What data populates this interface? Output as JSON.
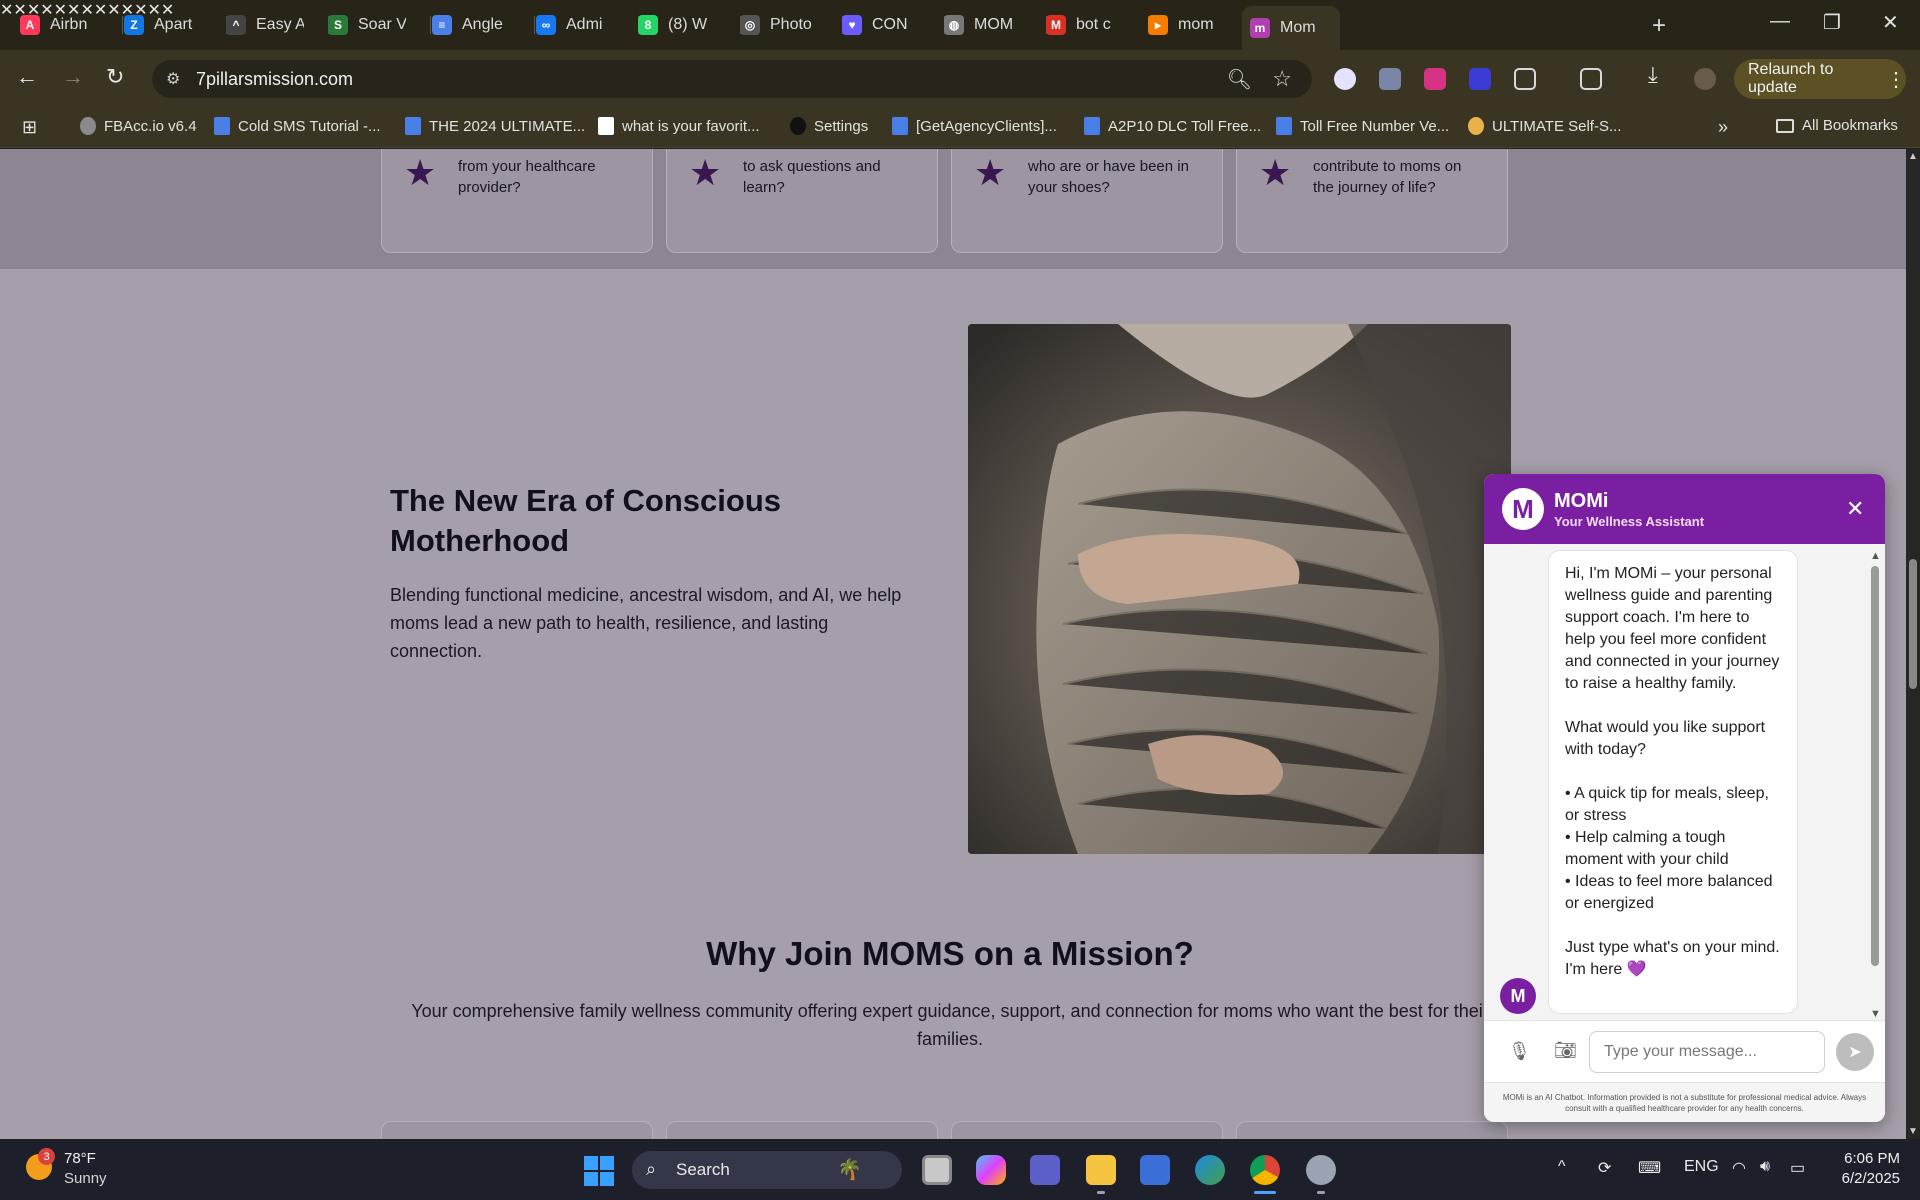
{
  "browser": {
    "tabs": [
      {
        "title": "Airbn",
        "icon": "airbnb-icon",
        "color": "#ff385c",
        "glyph": "A"
      },
      {
        "title": "Apart",
        "icon": "zillow-icon",
        "color": "#1277e1",
        "glyph": "Z"
      },
      {
        "title": "Easy A",
        "icon": "easy-icon",
        "color": "#444444",
        "glyph": "^"
      },
      {
        "title": "Soar V",
        "icon": "soar-icon",
        "color": "#2a7a3a",
        "glyph": "S"
      },
      {
        "title": "Angle",
        "icon": "docs-icon",
        "color": "#4a7fe8",
        "glyph": "≡"
      },
      {
        "title": "Admi",
        "icon": "meta-icon",
        "color": "#1877f2",
        "glyph": "∞"
      },
      {
        "title": "(8) W",
        "icon": "whatsapp-icon",
        "color": "#25d366",
        "glyph": "8"
      },
      {
        "title": "Photo",
        "icon": "openai-icon",
        "color": "#555555",
        "glyph": "◎"
      },
      {
        "title": "CON",
        "icon": "heart-chat-icon",
        "color": "#6a5cff",
        "glyph": "♥"
      },
      {
        "title": "MOM",
        "icon": "globe-icon",
        "color": "#777777",
        "glyph": "◍"
      },
      {
        "title": "bot c",
        "icon": "gmail-icon",
        "color": "#d93025",
        "glyph": "M"
      },
      {
        "title": "mom",
        "icon": "make-icon",
        "color": "#f57c00",
        "glyph": "▸"
      },
      {
        "title": "Mom",
        "icon": "mom-site-icon",
        "color": "#b03fb0",
        "glyph": "m"
      }
    ],
    "url": "7pillarsmission.com",
    "relaunch_label": "Relaunch to update",
    "bookmarks": [
      {
        "label": "FBAcc.io v6.4",
        "kind": "globe"
      },
      {
        "label": "Cold SMS Tutorial -...",
        "kind": "doc"
      },
      {
        "label": "THE 2024 ULTIMATE...",
        "kind": "doc"
      },
      {
        "label": "what is your favorit...",
        "kind": "ye"
      },
      {
        "label": "Settings",
        "kind": "tri"
      },
      {
        "label": "[GetAgencyClients]...",
        "kind": "doc"
      },
      {
        "label": "A2P10 DLC Toll Free...",
        "kind": "doc"
      },
      {
        "label": "Toll Free Number Ve...",
        "kind": "doc"
      },
      {
        "label": "ULTIMATE Self-S...",
        "kind": "emoji"
      }
    ],
    "all_bookmarks": "All Bookmarks",
    "more_bookmarks": "»"
  },
  "page": {
    "cards_top": [
      {
        "text": "from your healthcare provider?"
      },
      {
        "text": "to ask questions and learn?"
      },
      {
        "text": "who are or have been in your shoes?"
      },
      {
        "text": "contribute to moms on the journey of life?"
      }
    ],
    "hero_title": "The New Era of Conscious Motherhood",
    "hero_sub": "Blending functional medicine, ancestral wisdom, and AI, we help moms lead a new path to health, resilience, and lasting connection.",
    "why_title": "Why Join MOMS on a Mission?",
    "why_sub": "Your comprehensive family wellness community offering expert guidance, support, and connection for moms who want the best for their families."
  },
  "chat": {
    "avatar": "M",
    "name": "MOMi",
    "role": "Your Wellness Assistant",
    "close": "✕",
    "message": "Hi, I'm MOMi – your personal wellness guide and parenting support coach. I'm here to help you feel more confident and connected in your journey to raise a healthy family.\n\nWhat would you like support with today?\n\n• A quick tip for meals, sleep, or stress\n• Help calming a tough moment with your child\n• Ideas to feel more balanced or energized\n\nJust type what's on your mind. I'm here 💜",
    "input_placeholder": "Type your message...",
    "disclaimer": "MOMi is an AI Chatbot. Information provided is not a substitute for professional medical advice. Always consult with a qualified healthcare provider for any health concerns.",
    "accent": "#7b1fa2"
  },
  "taskbar": {
    "temp": "78°F",
    "condition": "Sunny",
    "weather_badge": "3",
    "search_label": "Search",
    "lang": "ENG",
    "time": "6:06 PM",
    "date": "6/2/2025"
  }
}
